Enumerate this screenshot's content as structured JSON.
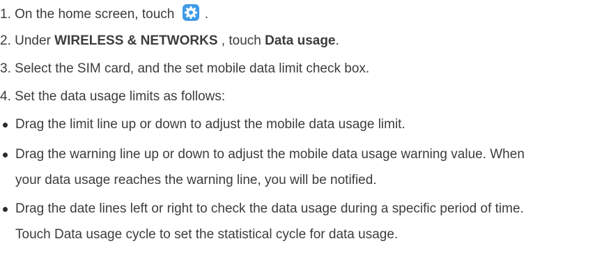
{
  "steps": [
    {
      "number": "1.",
      "text_before": "On the home screen, touch",
      "text_after": "."
    },
    {
      "number": "2.",
      "text_before": "Under",
      "bold1": "WIRELESS & NETWORKS",
      "text_mid": ", touch",
      "bold2": "Data usage",
      "text_after": "."
    },
    {
      "number": "3.",
      "text": "Select the SIM card, and the set mobile data limit check box."
    },
    {
      "number": "4.",
      "text": "Set the data usage limits as follows:"
    }
  ],
  "bullets": [
    {
      "lines": [
        "Drag the limit line up or down to adjust the mobile data usage limit."
      ]
    },
    {
      "lines": [
        "Drag the warning line up or down to adjust the mobile data usage warning value. When",
        "your data usage reaches the warning line, you will be notified."
      ]
    },
    {
      "lines": [
        "Drag the date lines left or right to check the data usage during a specific period of time.",
        "Touch Data usage cycle to set the statistical cycle for data usage."
      ]
    }
  ],
  "icons": {
    "settings": "settings-gear-icon",
    "settings_color": "#3f9be8"
  }
}
